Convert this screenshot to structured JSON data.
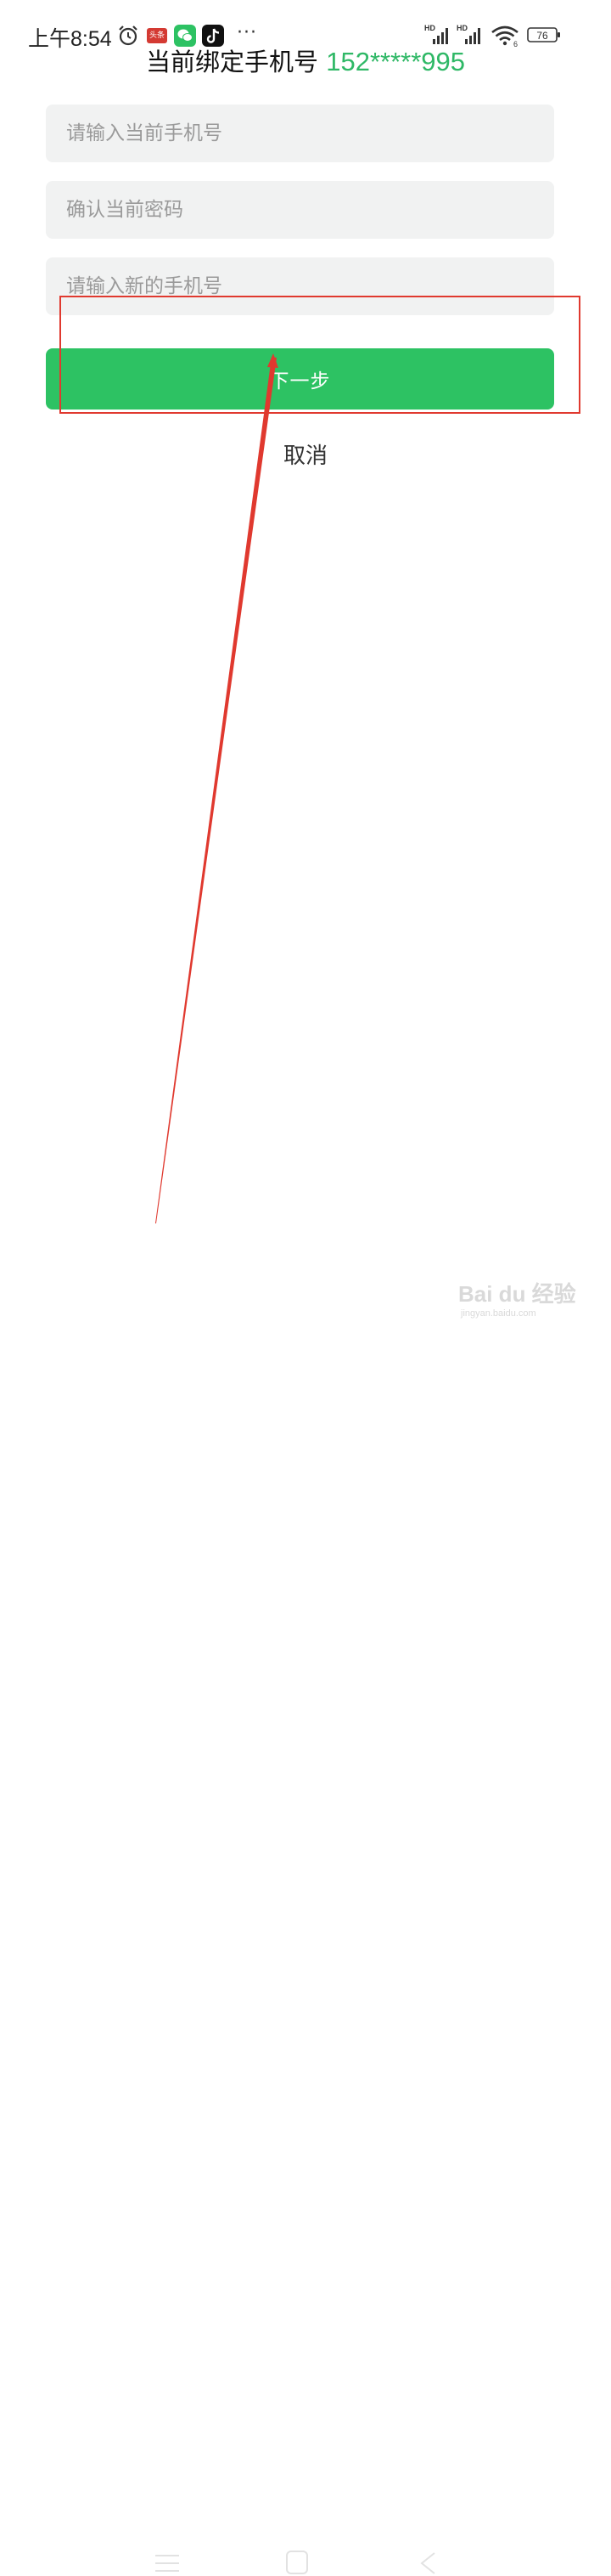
{
  "status_bar": {
    "time": "上午8:54",
    "toutiao_label": "头条",
    "more": "···",
    "network_labels": [
      "HD",
      "HD"
    ],
    "wifi_label": "6",
    "battery": "76",
    "icons": [
      "alarm-icon",
      "toutiao-icon",
      "wechat-icon",
      "douyin-icon",
      "signal-icon",
      "wifi-icon",
      "battery-icon"
    ]
  },
  "header": {
    "title_prefix": "当前绑定手机号",
    "bound_phone": "152*****995"
  },
  "form": {
    "current_phone_placeholder": "请输入当前手机号",
    "current_password_placeholder": "确认当前密码",
    "new_phone_placeholder": "请输入新的手机号",
    "next_label": "下一步",
    "cancel_label": "取消"
  },
  "nav": {
    "icons": [
      "menu-icon",
      "home-icon",
      "back-icon"
    ]
  },
  "watermark": {
    "text": "Bai du 经验",
    "url": "jingyan.baidu.com"
  },
  "colors": {
    "accent_green": "#2dc263",
    "phone_green": "#2fb866",
    "field_bg": "#f1f2f2",
    "annotation_red": "#e0392f"
  }
}
